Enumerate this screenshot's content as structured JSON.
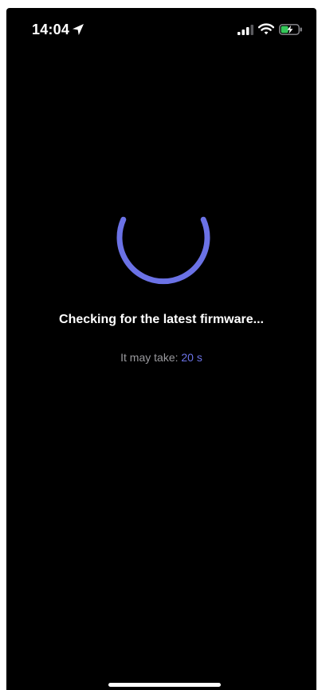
{
  "status_bar": {
    "time": "14:04",
    "icons": [
      "location-arrow-icon",
      "cellular-signal-icon",
      "wifi-icon",
      "battery-charging-icon"
    ]
  },
  "loading": {
    "spinner_icon": "spinner-icon",
    "message": "Checking for the latest firmware...",
    "eta_label": "It may take:",
    "eta_value": "20 s"
  },
  "colors": {
    "background": "#000000",
    "accent": "#6b72e6",
    "secondary_text": "#9a9a9e",
    "battery_charge": "#34c759"
  }
}
